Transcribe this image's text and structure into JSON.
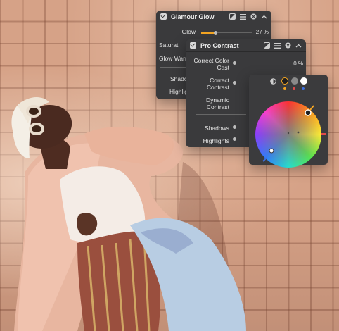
{
  "glamour_glow": {
    "title": "Glamour Glow",
    "rows": [
      {
        "label": "Glow",
        "value": "27 %",
        "level": 0.27
      },
      {
        "label": "Saturat"
      },
      {
        "label": "Glow Warr"
      },
      {
        "label": "Shado"
      },
      {
        "label": "Highlig"
      }
    ]
  },
  "pro_contrast": {
    "title": "Pro Contrast",
    "rows": [
      {
        "label": "Correct Color Cast",
        "value": "0 %"
      },
      {
        "label": "Correct Contrast"
      },
      {
        "label": "Dynamic Contrast"
      },
      {
        "label": "Shadows"
      },
      {
        "label": "Highlights"
      }
    ]
  },
  "picker": {
    "accent": "#f5a623",
    "swatch_colors": [
      "#f5a623",
      "#8a8a8a",
      "#ffffff"
    ],
    "dot_colors": [
      "#f5a623",
      "#e24a4a",
      "#3b6fe0"
    ]
  },
  "icons": [
    "checkbox-icon",
    "mask-icon",
    "menu-icon",
    "close-icon",
    "collapse-icon",
    "half-circle-icon"
  ]
}
